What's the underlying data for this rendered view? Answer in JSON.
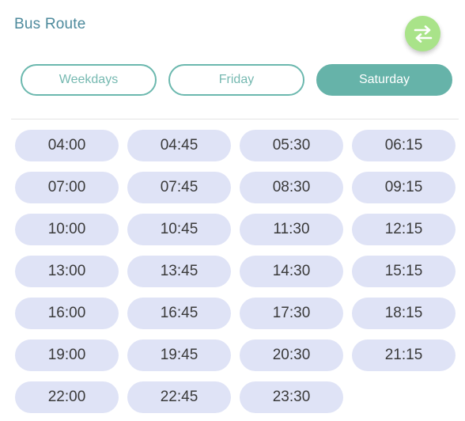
{
  "header": {
    "title": "Bus Route",
    "swap_icon": "swap-arrows-icon"
  },
  "colors": {
    "title": "#4d8a9c",
    "swap_button": "#a9e389",
    "tab_accent": "#66b3a9",
    "time_chip_bg": "#dfe3f6"
  },
  "tabs": [
    {
      "label": "Weekdays",
      "active": false
    },
    {
      "label": "Friday",
      "active": false
    },
    {
      "label": "Saturday",
      "active": true
    }
  ],
  "times": [
    "04:00",
    "04:45",
    "05:30",
    "06:15",
    "07:00",
    "07:45",
    "08:30",
    "09:15",
    "10:00",
    "10:45",
    "11:30",
    "12:15",
    "13:00",
    "13:45",
    "14:30",
    "15:15",
    "16:00",
    "16:45",
    "17:30",
    "18:15",
    "19:00",
    "19:45",
    "20:30",
    "21:15",
    "22:00",
    "22:45",
    "23:30"
  ]
}
